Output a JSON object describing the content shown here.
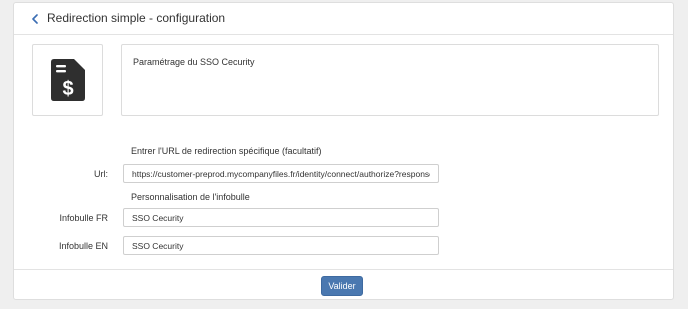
{
  "header": {
    "back_icon": "chevron-left-icon",
    "title": "Redirection simple - configuration"
  },
  "summary": {
    "icon": "invoice-dollar-document-icon",
    "description": "Paramétrage du SSO Cecurity"
  },
  "redirect": {
    "section_label": "Entrer l'URL de redirection spécifique (facultatif)",
    "url_label": "Url:",
    "url_value": "https://customer-preprod.mycompanyfiles.fr/identity/connect/authorize?response_type=code"
  },
  "tooltip": {
    "section_label": "Personnalisation de l'infobulle",
    "fr_label": "Infobulle FR",
    "fr_value": "SSO Cecurity",
    "en_label": "Infobulle EN",
    "en_value": "SSO Cecurity"
  },
  "footer": {
    "submit_label": "Valider"
  },
  "colors": {
    "accent": "#4a78b0",
    "back_icon": "#3a6db3",
    "icon_fill": "#2f2f2f"
  }
}
